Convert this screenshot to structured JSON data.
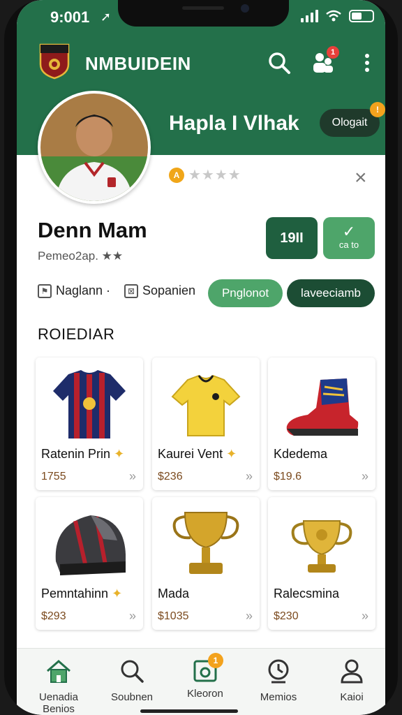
{
  "status_bar": {
    "time": "9:001",
    "location_glyph": "➚"
  },
  "header": {
    "app_title": "NMBUIDEIN",
    "notification_count": "1"
  },
  "profile": {
    "header_name": "Hapla I Vlhak",
    "logout_label": "Ologait",
    "logout_badge": "!",
    "rating_coin": "A",
    "rating_stars": "★★★★",
    "player_name": "Denn Mam",
    "player_sub": "Pemeo2ap. ★★",
    "stat_primary": "19II",
    "stat_secondary_label": "ca to",
    "meta_1": "Naglann ·",
    "meta_2": "Sopanien",
    "tab_1": "Pnglonot",
    "tab_2": "laveeciamb"
  },
  "section_title": "ROIEDIAR",
  "products": [
    {
      "name": "Ratenin Prin",
      "price": "1755",
      "icon": "jersey-icon"
    },
    {
      "name": "Kaurei Vent",
      "price": "$236",
      "icon": "yellow-shirt-icon"
    },
    {
      "name": "Kdedema",
      "price": "$19.6",
      "icon": "boot-icon"
    },
    {
      "name": "Pemntahinn",
      "price": "$293",
      "icon": "helmet-icon"
    },
    {
      "name": "Mada",
      "price": "$1035",
      "icon": "trophy-icon"
    },
    {
      "name": "Ralecsmina",
      "price": "$230",
      "icon": "cup-icon"
    }
  ],
  "bottom_nav": [
    {
      "label": "Uenadia",
      "label2": "Benios",
      "icon": "home-icon"
    },
    {
      "label": "Soubnen",
      "icon": "search-icon"
    },
    {
      "label": "Kleoron",
      "icon": "camera-icon",
      "badge": "1"
    },
    {
      "label": "Memios",
      "icon": "clock-icon"
    },
    {
      "label": "Kaioi",
      "icon": "user-icon"
    }
  ],
  "colors": {
    "brand_green": "#23704a",
    "accent_green": "#4ea56a",
    "dark_green": "#1f5f3f"
  }
}
